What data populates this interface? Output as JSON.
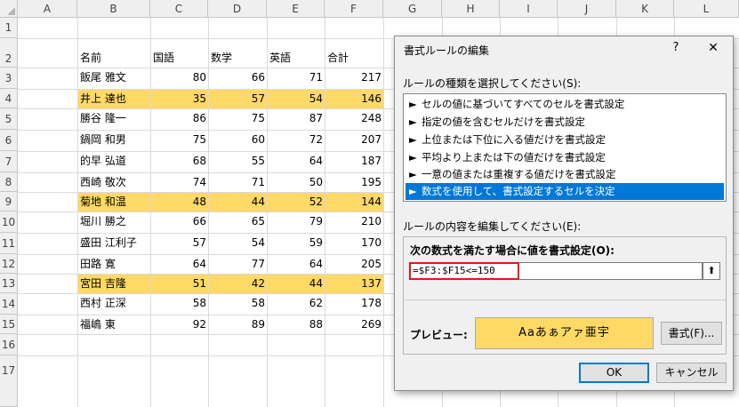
{
  "spreadsheet": {
    "columns": [
      "A",
      "B",
      "C",
      "D",
      "E",
      "F",
      "G",
      "H",
      "I",
      "J",
      "K",
      "L"
    ],
    "rows": [
      "1",
      "2",
      "3",
      "4",
      "5",
      "6",
      "7",
      "8",
      "9",
      "10",
      "11",
      "12",
      "13",
      "14",
      "15",
      "16",
      "17"
    ],
    "headers": [
      "名前",
      "国語",
      "数学",
      "英語",
      "合計"
    ],
    "records": [
      [
        "飯尾 雅文",
        "80",
        "66",
        "71",
        "217"
      ],
      [
        "井上 達也",
        "35",
        "57",
        "54",
        "146"
      ],
      [
        "勝谷 隆一",
        "86",
        "75",
        "87",
        "248"
      ],
      [
        "鍋岡 和男",
        "75",
        "60",
        "72",
        "207"
      ],
      [
        "的早 弘道",
        "68",
        "55",
        "64",
        "187"
      ],
      [
        "西崎 敬次",
        "74",
        "71",
        "50",
        "195"
      ],
      [
        "菊地 和温",
        "48",
        "44",
        "52",
        "144"
      ],
      [
        "堀川 勝之",
        "66",
        "65",
        "79",
        "210"
      ],
      [
        "盛田 江利子",
        "57",
        "54",
        "59",
        "170"
      ],
      [
        "田路 寛",
        "64",
        "77",
        "64",
        "205"
      ],
      [
        "宮田 吉隆",
        "51",
        "42",
        "44",
        "137"
      ],
      [
        "西村 正深",
        "58",
        "58",
        "62",
        "178"
      ],
      [
        "福嶋 東",
        "92",
        "89",
        "88",
        "269"
      ]
    ],
    "highlight_color": "#ffd966"
  },
  "dialog": {
    "title": "書式ルールの編集",
    "help": "?",
    "close": "✕",
    "rule_type_label": "ルールの種類を選択してください(S):",
    "rule_types": [
      "セルの値に基づいてすべてのセルを書式設定",
      "指定の値を含むセルだけを書式設定",
      "上位または下位に入る値だけを書式設定",
      "平均より上または下の値だけを書式設定",
      "一意の値または重複する値だけを書式設定",
      "数式を使用して、書式設定するセルを決定"
    ],
    "selected_index": 5,
    "arrow": "►",
    "edit_label": "ルールの内容を編集してください(E):",
    "formula_label": "次の数式を満たす場合に値を書式設定(O):",
    "formula": "=$F3:$F15<=150",
    "collapse_icon": "⬆",
    "preview_label": "プレビュー:",
    "preview_text": "Aaあぁアァ亜宇",
    "format_button": "書式(F)...",
    "ok": "OK",
    "cancel": "キャンセル",
    "selection_color": "#0078d7",
    "formula_border_color": "#e81123"
  }
}
